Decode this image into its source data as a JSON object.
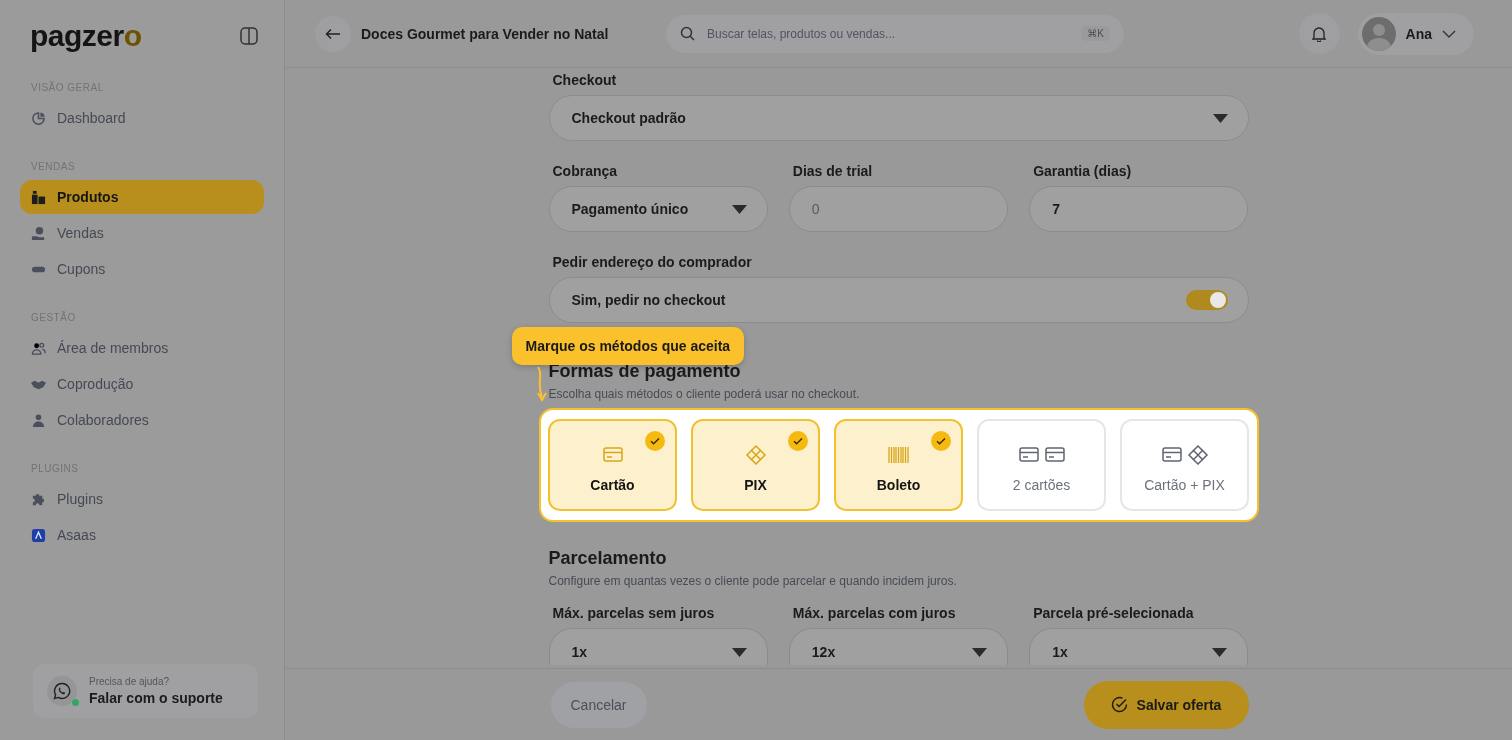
{
  "sidebar": {
    "logo": "pagzero",
    "sections": [
      {
        "title": "VISÃO GERAL",
        "items": [
          {
            "label": "Dashboard",
            "kind": "pie",
            "selected": false
          }
        ]
      },
      {
        "title": "VENDAS",
        "items": [
          {
            "label": "Produtos",
            "kind": "boxes",
            "selected": true
          },
          {
            "label": "Vendas",
            "kind": "coin",
            "selected": false
          },
          {
            "label": "Cupons",
            "kind": "ticket",
            "selected": false
          }
        ]
      },
      {
        "title": "GESTÃO",
        "items": [
          {
            "label": "Área de membros",
            "kind": "users",
            "selected": false
          },
          {
            "label": "Coprodução",
            "kind": "handshake",
            "selected": false
          },
          {
            "label": "Colaboradores",
            "kind": "user",
            "selected": false
          }
        ]
      },
      {
        "title": "PLUGINS",
        "items": [
          {
            "label": "Plugins",
            "kind": "puzzle",
            "selected": false
          },
          {
            "label": "Asaas",
            "kind": "app",
            "selected": false
          }
        ]
      }
    ],
    "support": {
      "caption": "Precisa de ajuda?",
      "label": "Falar com o suporte",
      "online": true
    }
  },
  "topbar": {
    "title": "Doces Gourmet para Vender no Natal",
    "search": {
      "placeholder": "Buscar telas, produtos ou vendas...",
      "shortcut": "⌘K"
    },
    "user": "Ana"
  },
  "form": {
    "checkout": {
      "label": "Checkout",
      "value": "Checkout padrão"
    },
    "billing": [
      {
        "label": "Cobrança",
        "kind": "select",
        "value": "Pagamento único"
      },
      {
        "label": "Dias de trial",
        "kind": "input",
        "placeholder": "0"
      },
      {
        "label": "Garantia (dias)",
        "kind": "input",
        "value": "7"
      }
    ],
    "address": {
      "label": "Pedir endereço do comprador",
      "value": "Sim, pedir no checkout",
      "on": true
    },
    "payment": {
      "title": "Formas de pagamento",
      "description": "Escolha quais métodos o cliente poderá usar no checkout.",
      "tooltip": "Marque os métodos que aceita",
      "methods": [
        {
          "label": "Cartão",
          "kind": "card",
          "selected": true
        },
        {
          "label": "PIX",
          "kind": "pix",
          "selected": true
        },
        {
          "label": "Boleto",
          "kind": "boleto",
          "selected": true
        },
        {
          "label": "2 cartões",
          "kind": "two_cards",
          "selected": false
        },
        {
          "label": "Cartão + PIX",
          "kind": "card_pix",
          "selected": false
        }
      ]
    },
    "installments": {
      "title": "Parcelamento",
      "description": "Configure em quantas vezes o cliente pode parcelar e quando incidem juros.",
      "fields": [
        {
          "label": "Máx. parcelas sem juros",
          "value": "1x"
        },
        {
          "label": "Máx. parcelas com juros",
          "value": "12x"
        },
        {
          "label": "Parcela pré-selecionada",
          "value": "1x"
        }
      ]
    }
  },
  "footer": {
    "cancel": "Cancelar",
    "save": "Salvar oferta"
  }
}
